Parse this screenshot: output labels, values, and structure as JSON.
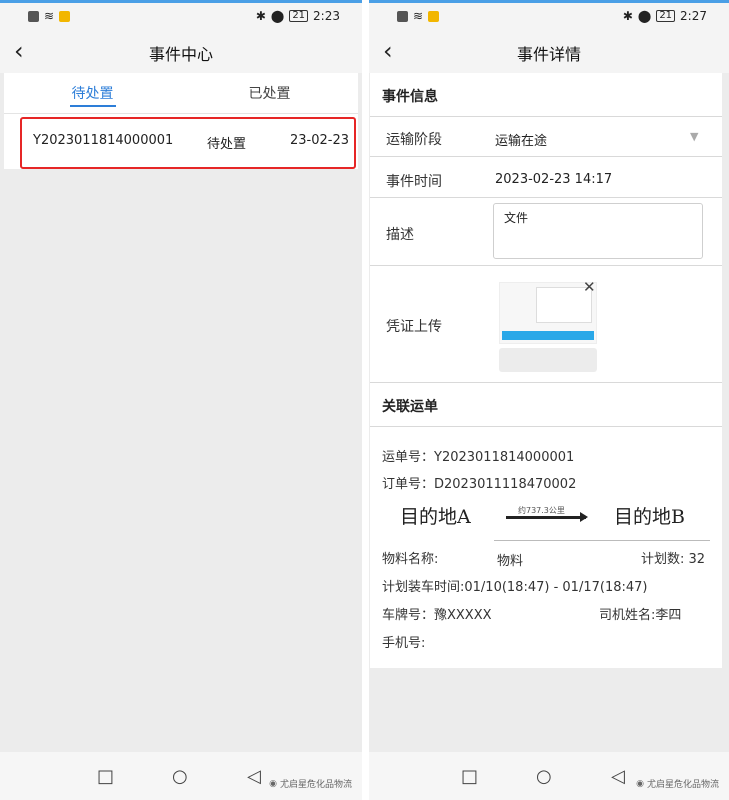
{
  "left": {
    "status": {
      "time": "2:23",
      "battery": "21"
    },
    "nav": {
      "title": "事件中心"
    },
    "tabs": [
      {
        "label": "待处置"
      },
      {
        "label": "已处置"
      }
    ],
    "row": {
      "id": "Y2023011814000001",
      "status": "待处置",
      "date": "23-02-23"
    },
    "watermark": "尤启星危化品物流"
  },
  "right": {
    "status": {
      "time": "2:27",
      "battery": "21"
    },
    "nav": {
      "title": "事件详情"
    },
    "event_section_title": "事件信息",
    "stage": {
      "label": "运输阶段",
      "value": "运输在途"
    },
    "time": {
      "label": "事件时间",
      "value": "2023-02-23 14:17"
    },
    "desc": {
      "label": "描述",
      "value": "文件"
    },
    "upload": {
      "label": "凭证上传"
    },
    "waybill_section_title": "关联运单",
    "waybill": {
      "waybill_no": "运单号：Y2023011814000001",
      "order_no": "订单号：D2023011118470002",
      "origin": "目的地A",
      "distance": "约737.3公里",
      "destination": "目的地B",
      "material_label": "物料名称:",
      "material_value": "物料",
      "plan_qty": "计划数: 32",
      "load_time": "计划装车时间:01/10(18:47) - 01/17(18:47)",
      "plate": "车牌号：豫XXXXX",
      "driver": "司机姓名:李四",
      "phone": "手机号:"
    },
    "watermark": "尤启星危化品物流"
  }
}
